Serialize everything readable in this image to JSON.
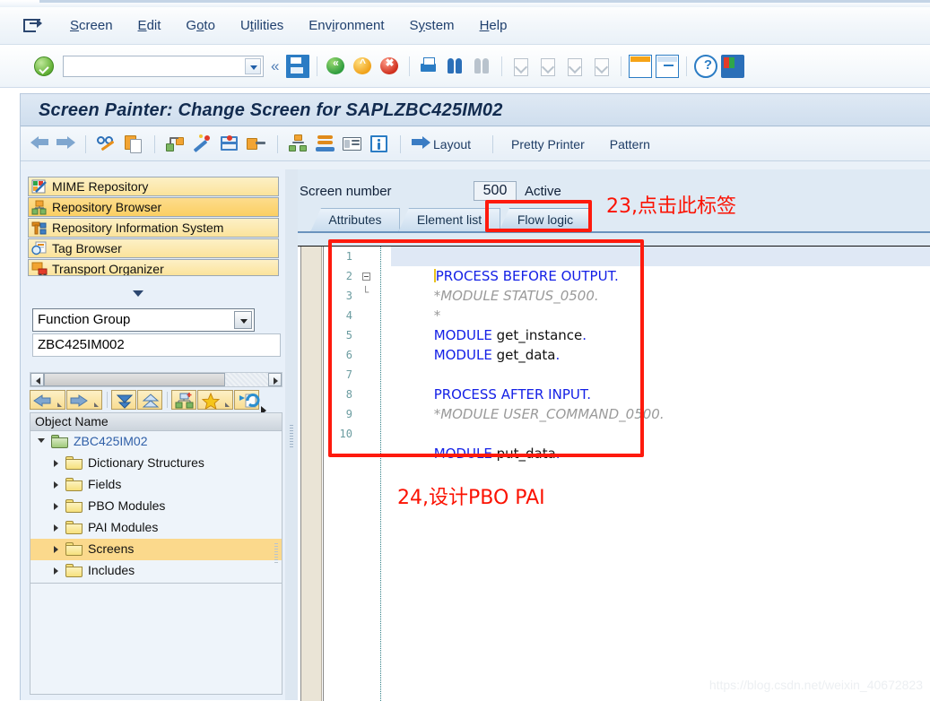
{
  "menu": {
    "app_icon": "exit-window-icon",
    "items": [
      {
        "label": "Screen",
        "accel_index": 1
      },
      {
        "label": "Edit",
        "accel_index": 0
      },
      {
        "label": "Goto",
        "accel_index": 1
      },
      {
        "label": "Utilities",
        "accel_index": 1
      },
      {
        "label": "Environment",
        "accel_index": 3
      },
      {
        "label": "System",
        "accel_index": 1
      },
      {
        "label": "Help",
        "accel_index": 0
      }
    ]
  },
  "toolbar": {
    "enter_icon": "green-check-enter-icon",
    "command_field_value": "",
    "command_field_placeholder": "",
    "more_chevron": "«",
    "icons": [
      "save-icon",
      "back-icon",
      "exit-icon",
      "cancel-icon",
      "print-icon",
      "find-icon",
      "find-next-icon",
      "first-page-icon",
      "previous-page-icon",
      "next-page-icon",
      "last-page-icon",
      "create-session-icon",
      "create-shortcut-icon",
      "help-icon",
      "customize-local-layout-icon"
    ]
  },
  "window": {
    "title": "Screen Painter: Change Screen for SAPLZBC425IM02"
  },
  "subtoolbar": {
    "icons": [
      "back-arrow-icon",
      "forward-arrow-icon",
      "display-change-icon",
      "copy-icon",
      "object-list-icon",
      "magic-wand-icon",
      "flow-logic-icon",
      "forward-navigation-icon",
      "hierarchy-icon",
      "stack-icon",
      "element-list-icon",
      "info-icon"
    ],
    "layout_label": "Layout",
    "pretty_printer_label": "Pretty Printer",
    "pattern_label": "Pattern"
  },
  "sidebar": {
    "nav_items": [
      {
        "label": "MIME Repository",
        "icon": "mime-repository-icon",
        "selected": false
      },
      {
        "label": "Repository Browser",
        "icon": "repository-browser-icon",
        "selected": true
      },
      {
        "label": "Repository Information System",
        "icon": "repository-info-system-icon",
        "selected": false
      },
      {
        "label": "Tag Browser",
        "icon": "tag-browser-icon",
        "selected": false
      },
      {
        "label": "Transport Organizer",
        "icon": "transport-organizer-icon",
        "selected": false
      }
    ],
    "object_type_select": "Function Group",
    "object_name_value": "ZBC425IM002",
    "tree_toolbar_icons": [
      "back-icon",
      "forward-icon",
      "expand-all-icon",
      "collapse-all-icon",
      "display-object-list-icon",
      "favorites-icon",
      "refresh-icon",
      "more-icon"
    ],
    "tree_header": "Object Name",
    "tree": [
      {
        "label": "ZBC425IM02",
        "depth": 0,
        "expanded": true,
        "icon": "open-folder-icon",
        "selected": false
      },
      {
        "label": "Dictionary Structures",
        "depth": 1,
        "expanded": false,
        "icon": "folder-icon",
        "selected": false
      },
      {
        "label": "Fields",
        "depth": 1,
        "expanded": false,
        "icon": "folder-icon",
        "selected": false
      },
      {
        "label": "PBO Modules",
        "depth": 1,
        "expanded": false,
        "icon": "folder-icon",
        "selected": false
      },
      {
        "label": "PAI Modules",
        "depth": 1,
        "expanded": false,
        "icon": "folder-icon",
        "selected": false
      },
      {
        "label": "Screens",
        "depth": 1,
        "expanded": false,
        "icon": "folder-icon",
        "selected": true
      },
      {
        "label": "Includes",
        "depth": 1,
        "expanded": false,
        "icon": "folder-icon",
        "selected": false
      }
    ]
  },
  "main": {
    "screen_number_label": "Screen number",
    "screen_number_value": "500",
    "status_label": "Active",
    "tabs": [
      {
        "label": "Attributes",
        "active": false
      },
      {
        "label": "Element list",
        "active": false
      },
      {
        "label": "Flow logic",
        "active": true
      }
    ]
  },
  "editor": {
    "lines": [
      {
        "no": "1",
        "highlight": true,
        "fold": "",
        "caret": true,
        "segments": [
          {
            "t": "PROCESS BEFORE OUTPUT.",
            "c": "kw"
          }
        ]
      },
      {
        "no": "2",
        "highlight": false,
        "fold": "box",
        "caret": false,
        "segments": [
          {
            "t": "*MODULE STATUS_0500.",
            "c": "cmt"
          }
        ]
      },
      {
        "no": "3",
        "highlight": false,
        "fold": "end",
        "caret": false,
        "segments": [
          {
            "t": "*",
            "c": "cmt"
          }
        ]
      },
      {
        "no": "4",
        "highlight": false,
        "fold": "",
        "caret": false,
        "segments": [
          {
            "t": "MODULE ",
            "c": "kw"
          },
          {
            "t": "get_instance",
            "c": "plain"
          },
          {
            "t": ".",
            "c": "kw"
          }
        ]
      },
      {
        "no": "5",
        "highlight": false,
        "fold": "",
        "caret": false,
        "segments": [
          {
            "t": "MODULE ",
            "c": "kw"
          },
          {
            "t": "get_data",
            "c": "plain"
          },
          {
            "t": ".",
            "c": "kw"
          }
        ]
      },
      {
        "no": "6",
        "highlight": false,
        "fold": "",
        "caret": false,
        "segments": [
          {
            "t": "",
            "c": "plain"
          }
        ]
      },
      {
        "no": "7",
        "highlight": false,
        "fold": "",
        "caret": false,
        "segments": [
          {
            "t": "PROCESS AFTER INPUT.",
            "c": "kw"
          }
        ]
      },
      {
        "no": "8",
        "highlight": false,
        "fold": "",
        "caret": false,
        "segments": [
          {
            "t": "*MODULE USER_COMMAND_0500.",
            "c": "cmt"
          }
        ]
      },
      {
        "no": "9",
        "highlight": false,
        "fold": "",
        "caret": false,
        "segments": [
          {
            "t": "",
            "c": "plain"
          }
        ]
      },
      {
        "no": "10",
        "highlight": false,
        "fold": "",
        "caret": false,
        "segments": [
          {
            "t": "MODULE ",
            "c": "kw"
          },
          {
            "t": "put_data",
            "c": "plain"
          },
          {
            "t": ".",
            "c": "kw"
          }
        ]
      }
    ]
  },
  "annotations": [
    {
      "text": "23,点击此标签",
      "name": "annotation-click-this-tab"
    },
    {
      "text": "24,设计PBO PAI",
      "name": "annotation-design-pbo-pai"
    }
  ],
  "watermark": "https://blog.csdn.net/weixin_40672823",
  "colors": {
    "annotation_red": "#fb1202",
    "keyword_blue": "#1420e6",
    "comment_gray": "#9a9a9a",
    "selection_amber": "#fbd98c",
    "title_navy": "#122b4f"
  }
}
